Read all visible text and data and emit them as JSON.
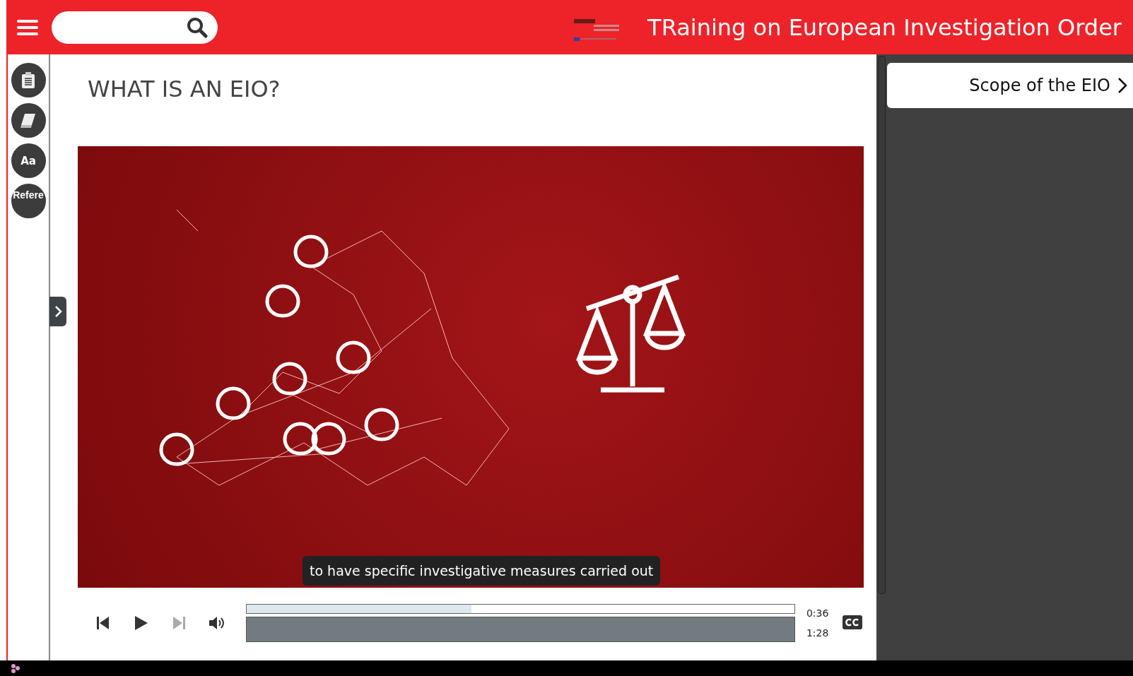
{
  "header": {
    "title": "TRaining on European Investigation Order"
  },
  "rail": [
    {
      "kind": "clipboard"
    },
    {
      "kind": "book"
    },
    {
      "kind": "text",
      "label": "Aa"
    },
    {
      "kind": "text",
      "label": "Refere"
    }
  ],
  "page": {
    "title": "WHAT IS AN EIO?",
    "next_button": "Scope of the EIO"
  },
  "player": {
    "caption": "to have specific investigative measures carried out",
    "controls": [
      {
        "kind": "previous",
        "disabled": false
      },
      {
        "kind": "play",
        "disabled": false
      },
      {
        "kind": "next",
        "disabled": true
      },
      {
        "kind": "volume",
        "disabled": false
      }
    ],
    "progress": {
      "level": 0.41
    },
    "current_time": "0:36",
    "duration": "1:28"
  }
}
